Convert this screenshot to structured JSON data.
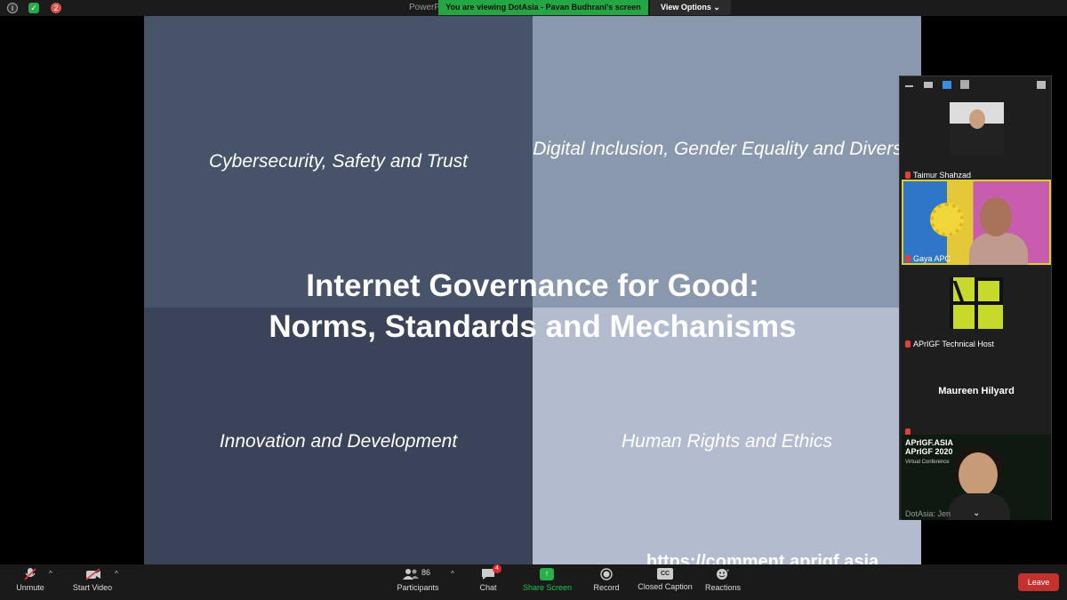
{
  "topbar": {
    "title_partial": "PowerP",
    "banner": "You are viewing DotAsia - Pavan Budhrani's screen",
    "view_options": "View Options",
    "notification_count": "2"
  },
  "slide": {
    "q1_text": "Cybersecurity, Safety and Trust",
    "q2_text": "Digital Inclusion, Gender Equality and Diversity",
    "q3_text": "Innovation and Development",
    "q4_text": "Human Rights and Ethics",
    "title_line1": "Internet Governance for Good:",
    "title_line2": "Norms, Standards and Mechanisms",
    "url": "https://comment.aprigf.asia"
  },
  "participants_panel": {
    "tiles": [
      {
        "name": "Taimur Shahzad"
      },
      {
        "name": "Gaya APC"
      },
      {
        "name": "APrIGF Technical Host"
      },
      {
        "name": "Maureen Hilyard"
      },
      {
        "name": "DotAsia: Jen"
      }
    ],
    "aprigf_brand": "APrIGF.ASIA",
    "aprigf_event": "APrIGF 2020",
    "aprigf_sub": "Virtual Conference"
  },
  "toolbar": {
    "unmute": "Unmute",
    "start_video": "Start Video",
    "participants": "Participants",
    "participants_count": "86",
    "chat": "Chat",
    "chat_badge": "4",
    "share_screen": "Share Screen",
    "record": "Record",
    "closed_caption": "Closed Caption",
    "closed_caption_icon": "CC",
    "reactions": "Reactions",
    "leave": "Leave"
  },
  "colors": {
    "banner_green": "#25a644",
    "leave_red": "#c4312e",
    "q1": "#475368",
    "q2": "#8a98ae",
    "q3": "#3a4357",
    "q4": "#b2bcce"
  }
}
